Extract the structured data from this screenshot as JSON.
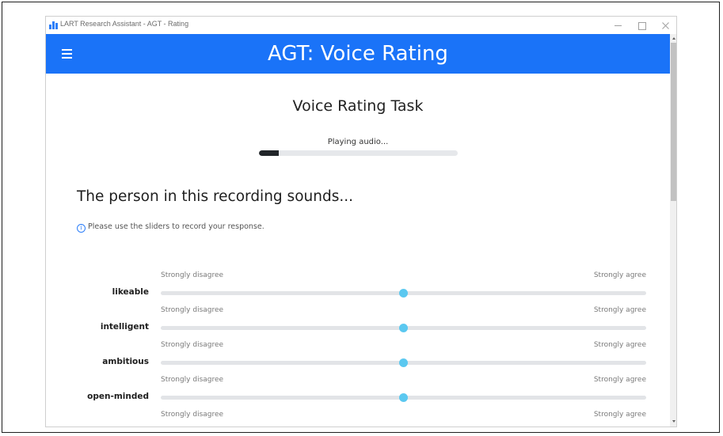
{
  "window": {
    "title": "LART Research Assistant - AGT - Rating"
  },
  "appbar": {
    "title": "AGT: Voice Rating",
    "menu_icon": "hamburger-menu-icon"
  },
  "task": {
    "title": "Voice Rating Task",
    "audio_status": "Playing audio...",
    "audio_progress_fraction": 0.1
  },
  "question": {
    "heading": "The person in this recording sounds...",
    "info_icon": "info-icon",
    "info_text": "Please use the sliders to record your response."
  },
  "scale": {
    "left_anchor": "Strongly disagree",
    "right_anchor": "Strongly agree"
  },
  "items": [
    {
      "label": "likeable",
      "value_fraction": 0.5
    },
    {
      "label": "intelligent",
      "value_fraction": 0.5
    },
    {
      "label": "ambitious",
      "value_fraction": 0.5
    },
    {
      "label": "open-minded",
      "value_fraction": 0.5
    }
  ],
  "colors": {
    "appbar": "#1a73f8",
    "slider_thumb": "#5bc8f0",
    "progress_fill": "#212529"
  }
}
